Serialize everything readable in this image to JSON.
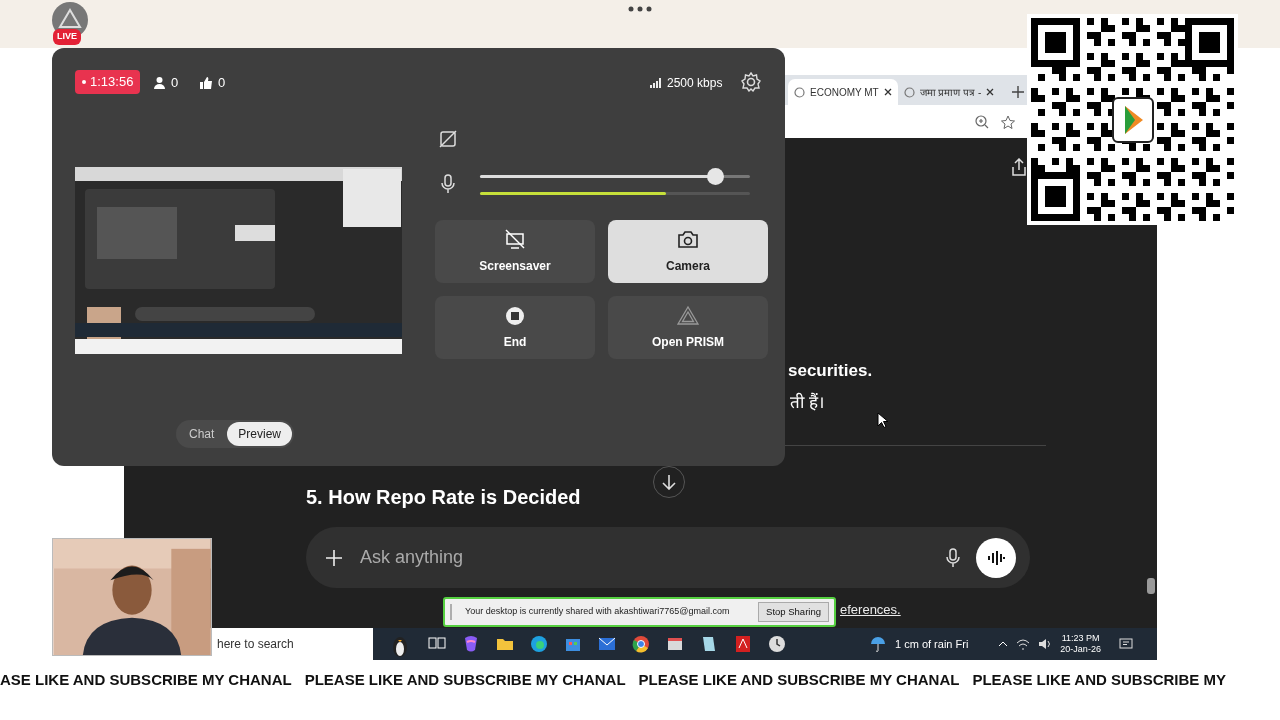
{
  "live_badge": {
    "label": "LIVE"
  },
  "stream_status": {
    "timer": "1:13:56",
    "viewers": "0",
    "likes": "0",
    "bitrate": "2500 kbps"
  },
  "browser": {
    "tabs": [
      {
        "label": "ECONOMY MT",
        "selected": true
      },
      {
        "label": "जमा प्रमाण पत्र -",
        "selected": false
      }
    ]
  },
  "chat": {
    "lines": [
      {
        "text": "securities."
      },
      {
        "text": "ती हैं।"
      }
    ],
    "heading": "5. How Repo Rate is Decided",
    "placeholder": "Ask anything",
    "footer_link": "eferences."
  },
  "stream_panel": {
    "mic": {
      "level": 0.87
    },
    "meter": {
      "level": 0.69
    },
    "tiles": [
      {
        "kind": "screensaver",
        "label": "Screensaver",
        "selected": false
      },
      {
        "kind": "camera",
        "label": "Camera",
        "selected": true
      },
      {
        "kind": "end",
        "label": "End",
        "selected": false
      },
      {
        "kind": "prism",
        "label": "Open PRISM",
        "selected": false
      }
    ],
    "view_toggle": [
      {
        "label": "Chat",
        "selected": false
      },
      {
        "label": "Preview",
        "selected": true
      }
    ]
  },
  "share_bar": {
    "message": "Your desktop is currently shared with akashtiwari7765@gmail.com",
    "button": "Stop Sharing"
  },
  "taskbar": {
    "placeholder": "here to search",
    "weather": "1 cm of rain Fri",
    "time": "11:23 PM",
    "date": "20-Jan-26"
  },
  "ticker": [
    "ASE LIKE AND SUBSCRIBE MY CHANAL",
    "PLEASE LIKE AND SUBSCRIBE MY CHANAL",
    "PLEASE LIKE AND SUBSCRIBE MY CHANAL",
    "PLEASE LIKE AND SUBSCRIBE MY"
  ]
}
